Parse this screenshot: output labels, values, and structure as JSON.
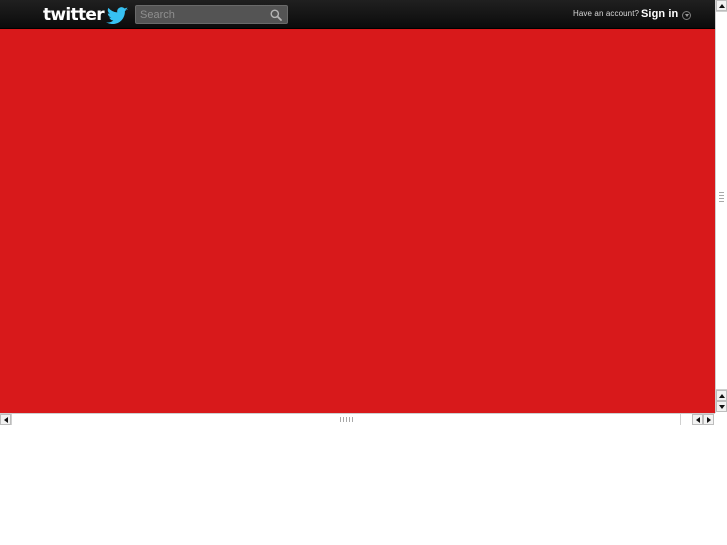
{
  "header": {
    "logo_text": "twitter",
    "search": {
      "value": "",
      "placeholder": "Search"
    },
    "account_prompt": "Have an account?",
    "sign_in_label": "Sign in"
  },
  "icons": {
    "logo_bird": "twitter-bird-icon",
    "search": "search-icon",
    "sign_in_dropdown": "chevron-down-icon"
  },
  "colors": {
    "background": "#d8191b",
    "topbar": "#111111",
    "topbar_text": "#ffffff"
  }
}
